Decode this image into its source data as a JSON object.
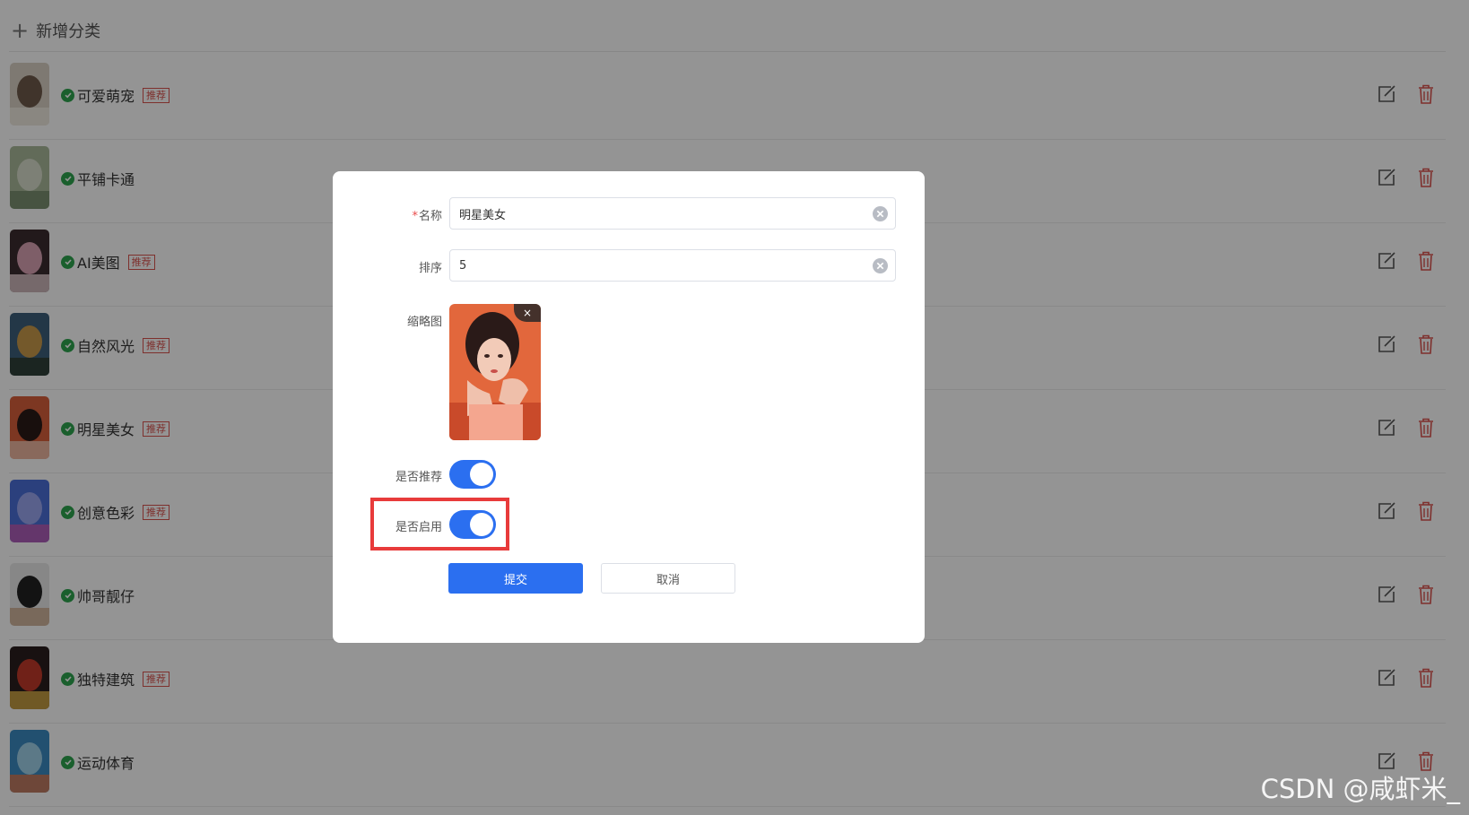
{
  "toolbar": {
    "add_label": "新增分类"
  },
  "tag_text": "推荐",
  "categories": [
    {
      "name": "可爱萌宠",
      "recommended": true,
      "enabled": true
    },
    {
      "name": "平铺卡通",
      "recommended": false,
      "enabled": true
    },
    {
      "name": "AI美图",
      "recommended": true,
      "enabled": true
    },
    {
      "name": "自然风光",
      "recommended": true,
      "enabled": true
    },
    {
      "name": "明星美女",
      "recommended": true,
      "enabled": true
    },
    {
      "name": "创意色彩",
      "recommended": true,
      "enabled": true
    },
    {
      "name": "帅哥靓仔",
      "recommended": false,
      "enabled": true
    },
    {
      "name": "独特建筑",
      "recommended": true,
      "enabled": true
    },
    {
      "name": "运动体育",
      "recommended": false,
      "enabled": true
    }
  ],
  "form": {
    "name_label": "名称",
    "name_required_mark": "*",
    "name_value": "明星美女",
    "sort_label": "排序",
    "sort_value": "5",
    "thumb_label": "缩略图",
    "thumb_remove": "×",
    "recommend_label": "是否推荐",
    "recommend_on": true,
    "enable_label": "是否启用",
    "enable_on": true,
    "submit_label": "提交",
    "cancel_label": "取消"
  },
  "colors": {
    "primary": "#2b6ff0",
    "check": "#2ea44f",
    "delete": "#d9534f",
    "highlight": "#e83b3b"
  },
  "watermark": "CSDN @咸虾米_"
}
